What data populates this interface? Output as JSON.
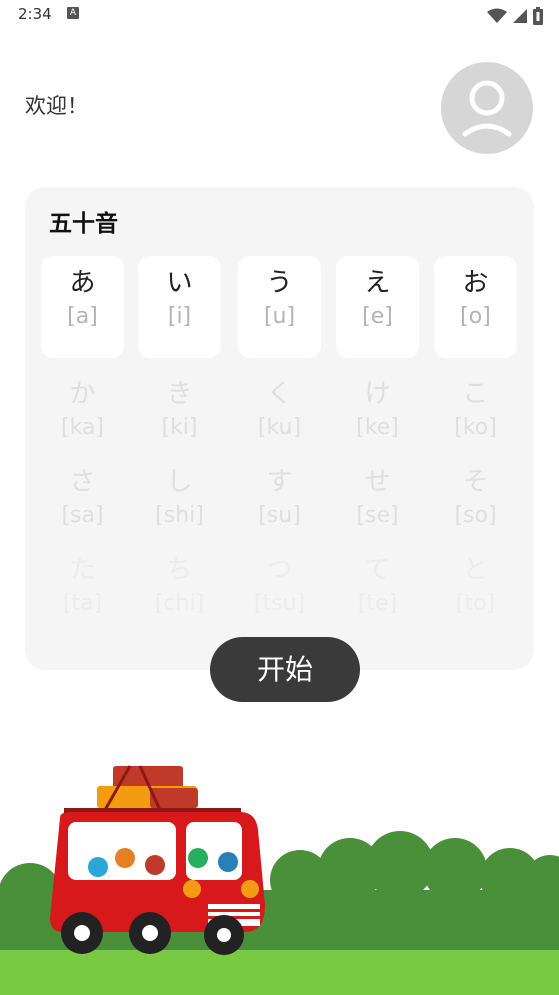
{
  "status_bar": {
    "time": "2:34",
    "notification_icon": "A"
  },
  "header": {
    "welcome": "欢迎！"
  },
  "card": {
    "title": "五十音",
    "rows": [
      [
        {
          "kana": "あ",
          "romaji": "[a]"
        },
        {
          "kana": "い",
          "romaji": "[i]"
        },
        {
          "kana": "う",
          "romaji": "[u]"
        },
        {
          "kana": "え",
          "romaji": "[e]"
        },
        {
          "kana": "お",
          "romaji": "[o]"
        }
      ],
      [
        {
          "kana": "か",
          "romaji": "[ka]"
        },
        {
          "kana": "き",
          "romaji": "[ki]"
        },
        {
          "kana": "く",
          "romaji": "[ku]"
        },
        {
          "kana": "け",
          "romaji": "[ke]"
        },
        {
          "kana": "こ",
          "romaji": "[ko]"
        }
      ],
      [
        {
          "kana": "さ",
          "romaji": "[sa]"
        },
        {
          "kana": "し",
          "romaji": "[shi]"
        },
        {
          "kana": "す",
          "romaji": "[su]"
        },
        {
          "kana": "せ",
          "romaji": "[se]"
        },
        {
          "kana": "そ",
          "romaji": "[so]"
        }
      ],
      [
        {
          "kana": "た",
          "romaji": "[ta]"
        },
        {
          "kana": "ち",
          "romaji": "[chi]"
        },
        {
          "kana": "つ",
          "romaji": "[tsu]"
        },
        {
          "kana": "て",
          "romaji": "[te]"
        },
        {
          "kana": "と",
          "romaji": "[to]"
        }
      ]
    ]
  },
  "start_button": {
    "label": "开始"
  },
  "colors": {
    "accent_dark": "#3a3a3a",
    "card_bg": "#f5f5f5",
    "grass": "#7ac943",
    "bush": "#4a8f3a",
    "bus": "#d7191c"
  },
  "icons": [
    "wifi-icon",
    "signal-icon",
    "battery-icon",
    "avatar-person-icon"
  ]
}
